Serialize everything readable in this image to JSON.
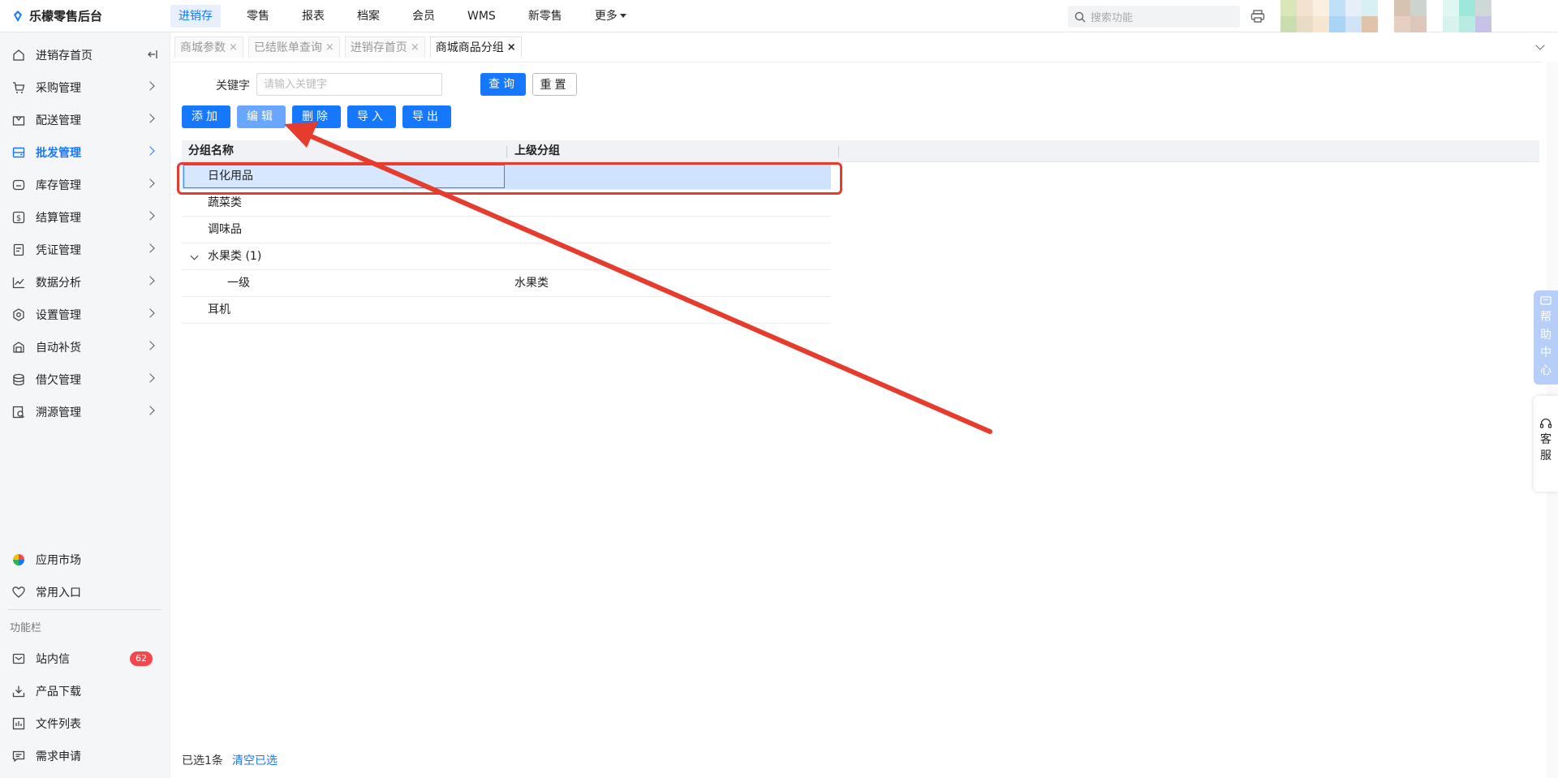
{
  "brand": {
    "name": "乐檬零售后台"
  },
  "topnav": [
    {
      "label": "进销存",
      "active": true
    },
    {
      "label": "零售"
    },
    {
      "label": "报表"
    },
    {
      "label": "档案"
    },
    {
      "label": "会员"
    },
    {
      "label": "WMS"
    },
    {
      "label": "新零售"
    },
    {
      "label": "更多"
    }
  ],
  "search": {
    "placeholder": "搜索功能"
  },
  "sidebar": {
    "items": [
      {
        "label": "进销存首页",
        "icon": "home-icon"
      },
      {
        "label": "采购管理",
        "icon": "cart-icon"
      },
      {
        "label": "配送管理",
        "icon": "delivery-icon"
      },
      {
        "label": "批发管理",
        "icon": "wholesale-icon",
        "active": true
      },
      {
        "label": "库存管理",
        "icon": "inventory-icon"
      },
      {
        "label": "结算管理",
        "icon": "dollar-icon"
      },
      {
        "label": "凭证管理",
        "icon": "voucher-icon"
      },
      {
        "label": "数据分析",
        "icon": "chart-icon"
      },
      {
        "label": "设置管理",
        "icon": "settings-icon"
      },
      {
        "label": "自动补货",
        "icon": "replenish-icon"
      },
      {
        "label": "借欠管理",
        "icon": "coins-icon"
      },
      {
        "label": "溯源管理",
        "icon": "trace-icon"
      }
    ],
    "bottom": [
      {
        "label": "应用市场",
        "icon": "app-market-icon"
      },
      {
        "label": "常用入口",
        "icon": "heart-icon"
      }
    ],
    "section_label": "功能栏",
    "tools": [
      {
        "label": "站内信",
        "icon": "mail-icon",
        "badge": "62"
      },
      {
        "label": "产品下载",
        "icon": "download-icon"
      },
      {
        "label": "文件列表",
        "icon": "file-list-icon"
      },
      {
        "label": "需求申请",
        "icon": "request-icon"
      }
    ]
  },
  "tabs": [
    {
      "label": "商城参数",
      "close": "×"
    },
    {
      "label": "已结账单查询",
      "close": "×"
    },
    {
      "label": "进销存首页",
      "close": "×"
    },
    {
      "label": "商城商品分组",
      "close": "×",
      "active": true
    }
  ],
  "filter": {
    "keyword_label": "关键字",
    "keyword_placeholder": "请输入关键字",
    "query_label": "查询",
    "reset_label": "重置"
  },
  "toolbar": {
    "add": "添加",
    "edit": "编辑",
    "delete": "删除",
    "import": "导入",
    "export": "导出"
  },
  "table": {
    "columns": [
      "分组名称",
      "上级分组"
    ],
    "rows": [
      {
        "name": "日化用品",
        "parent": "",
        "selected": true
      },
      {
        "name": "蔬菜类",
        "parent": ""
      },
      {
        "name": "调味品",
        "parent": ""
      },
      {
        "name": "水果类 (1)",
        "parent": "",
        "expanded": true
      },
      {
        "name": "一级",
        "parent": "水果类",
        "child": true
      },
      {
        "name": "耳机",
        "parent": ""
      }
    ]
  },
  "footer": {
    "selected": "已选1条",
    "clear": "清空已选"
  },
  "floats": {
    "help": "帮助中心",
    "service": "客服"
  },
  "colors": {
    "accent": "#1677ff",
    "annotation": "#e53c2e",
    "badge": "#f5484d"
  }
}
